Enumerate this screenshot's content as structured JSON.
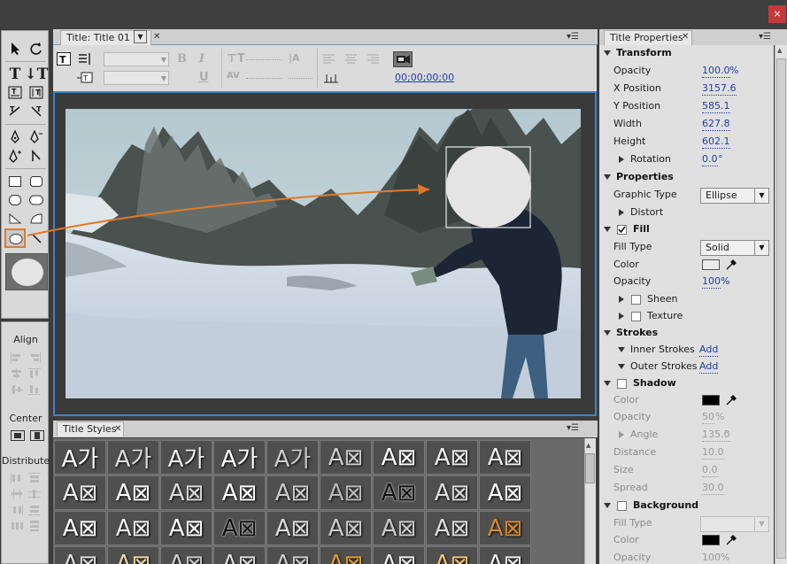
{
  "window": {
    "close_label": "×"
  },
  "title_panel": {
    "tab_label": "Title: Title 01",
    "timecode": "00;00;00;00"
  },
  "styles_panel": {
    "tab_label": "Title Styles",
    "rows": [
      [
        "A가",
        "A가",
        "A가",
        "A가",
        "A가",
        "A⊠",
        "A⊠",
        "A⊠",
        "A⊠"
      ],
      [
        "A⊠",
        "A⊠",
        "A⊠",
        "A⊠",
        "A⊠",
        "A⊠",
        "A⊠",
        "A⊠",
        "A⊠"
      ],
      [
        "A⊠",
        "A⊠",
        "A⊠",
        "A⊠",
        "A⊠",
        "A⊠",
        "A⊠",
        "A⊠",
        "A⊠"
      ],
      [
        "A⊠",
        "A⊠",
        "A⊠",
        "A⊠",
        "A⊠",
        "A⊠",
        "A⊠",
        "A⊠",
        "A⊠"
      ]
    ]
  },
  "align_panel": {
    "align_label": "Align",
    "center_label": "Center",
    "distribute_label": "Distribute"
  },
  "properties_panel": {
    "tab_label": "Title Properties",
    "transform": {
      "header": "Transform",
      "opacity_label": "Opacity",
      "opacity": "100.0",
      "opacity_unit": "%",
      "x_label": "X Position",
      "x": "3157.6",
      "y_label": "Y Position",
      "y": "585.1",
      "width_label": "Width",
      "width": "627.8",
      "height_label": "Height",
      "height": "602.1",
      "rotation_label": "Rotation",
      "rotation": "0.0",
      "rotation_unit": "°"
    },
    "properties": {
      "header": "Properties",
      "graphic_type_label": "Graphic Type",
      "graphic_type": "Ellipse",
      "distort_label": "Distort"
    },
    "fill": {
      "header": "Fill",
      "checked": true,
      "fill_type_label": "Fill Type",
      "fill_type": "Solid",
      "color_label": "Color",
      "color": "#ececec",
      "opacity_label": "Opacity",
      "opacity": "100",
      "opacity_unit": "%",
      "sheen_label": "Sheen",
      "texture_label": "Texture"
    },
    "strokes": {
      "header": "Strokes",
      "inner_label": "Inner Strokes",
      "inner_add": "Add",
      "outer_label": "Outer Strokes",
      "outer_add": "Add"
    },
    "shadow": {
      "header": "Shadow",
      "checked": false,
      "color_label": "Color",
      "color": "#000000",
      "opacity_label": "Opacity",
      "opacity": "50",
      "opacity_unit": "%",
      "angle_label": "Angle",
      "angle": "135.0",
      "angle_unit": "°",
      "distance_label": "Distance",
      "distance": "10.0",
      "size_label": "Size",
      "size": "0.0",
      "spread_label": "Spread",
      "spread": "30.0"
    },
    "background": {
      "header": "Background",
      "checked": false,
      "fill_type_label": "Fill Type",
      "fill_type": "",
      "color_label": "Color",
      "color": "#000000",
      "opacity_label": "Opacity",
      "opacity": "100",
      "opacity_unit": "%"
    }
  },
  "colors": {
    "accent": "#3b85c8",
    "annotation": "#e07a28",
    "link": "#1c3fa0"
  }
}
